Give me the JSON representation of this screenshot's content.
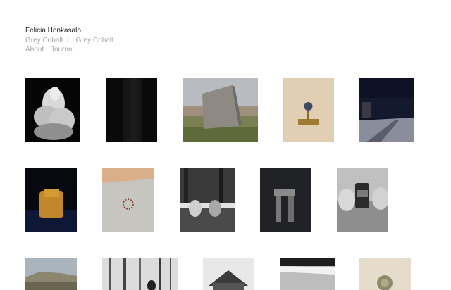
{
  "header": {
    "site_title": "Felicia Honkasalo",
    "nav_projects": [
      "Grey Cobalt II",
      "Grey Cobalt"
    ],
    "nav_pages": [
      "About",
      "Journal"
    ]
  },
  "gallery": {
    "items": [
      {
        "subject": "snow-covered tree at night"
      },
      {
        "subject": "dark textured surface"
      },
      {
        "subject": "stone monolith in landscape"
      },
      {
        "subject": "glass orb on golden stand"
      },
      {
        "subject": "snowy road at night"
      },
      {
        "subject": "golden figurine"
      },
      {
        "subject": "dotted circle on wall"
      },
      {
        "subject": "two people in forest"
      },
      {
        "subject": "stone arch on dark background"
      },
      {
        "subject": "jar on cushions"
      },
      {
        "subject": "hilltop landscape"
      },
      {
        "subject": "birch forest with figure"
      },
      {
        "subject": "wooden barn"
      },
      {
        "subject": "snow on roof edge"
      },
      {
        "subject": "round object on beige"
      }
    ]
  }
}
